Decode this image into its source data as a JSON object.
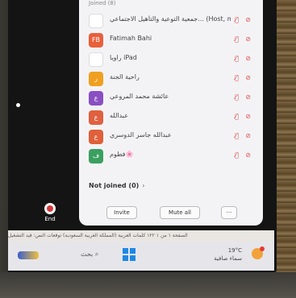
{
  "participants": {
    "header": "Joined (8)",
    "list": [
      {
        "initials": "",
        "color": "#ffffff",
        "name": "جمعية التوعية والتأهيل الاجتماعي... (Host, me)"
      },
      {
        "initials": "FB",
        "color": "#e8603a",
        "name": "Fatimah Bahi"
      },
      {
        "initials": "",
        "color": "#ffffff",
        "name": "راويا iPad"
      },
      {
        "initials": "ر",
        "color": "#f0a020",
        "name": "راحية الجنة"
      },
      {
        "initials": "ع",
        "color": "#8a4fc2",
        "name": "عائشة محمد المروعي"
      },
      {
        "initials": "ع",
        "color": "#e06040",
        "name": "عبدالله"
      },
      {
        "initials": "ع",
        "color": "#e0603a",
        "name": "عبدالله جاسر الدوسري"
      },
      {
        "initials": "ف",
        "color": "#3aa060",
        "name": "فطوم🌸"
      }
    ],
    "not_joined_label": "Not joined (0)",
    "not_joined_chevron": "›",
    "invite_label": "Invite",
    "mute_all_label": "Mute all",
    "more_label": "···"
  },
  "call": {
    "end_label": "End"
  },
  "statusbar": {
    "text": "الصفحة ١ من ١   ١٢٢ كلمات   العربية (المملكة العربية السعودية)   توقعات النص: قيد التشغيل"
  },
  "taskbar": {
    "search_label": "بحث",
    "weather_temp": "19°C",
    "weather_desc": "سماء صافية"
  }
}
